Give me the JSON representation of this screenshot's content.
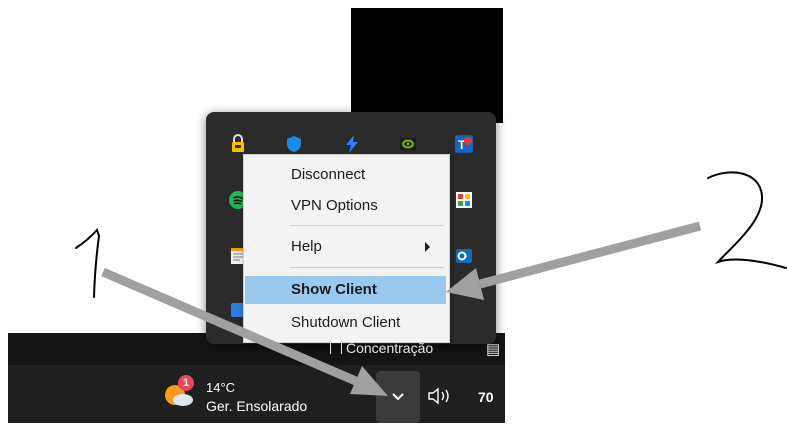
{
  "context_menu": {
    "items": [
      {
        "label": "Disconnect"
      },
      {
        "label": "VPN Options"
      },
      {
        "label": "Help"
      },
      {
        "label": "Show Client"
      },
      {
        "label": "Shutdown Client"
      }
    ]
  },
  "taskbar": {
    "focus_label": "Concentração",
    "weather": {
      "badge_count": "1",
      "temperature": "14°C",
      "condition": "Ger. Ensolarado"
    },
    "battery_text": "70"
  },
  "annotations": {
    "label_1": "1",
    "label_2": "2"
  },
  "colors": {
    "menu_highlight": "#99c9ef",
    "taskbar": "#1f1f1f",
    "flyout": "#2b2b2b",
    "arrow": "#a0a0a0"
  }
}
